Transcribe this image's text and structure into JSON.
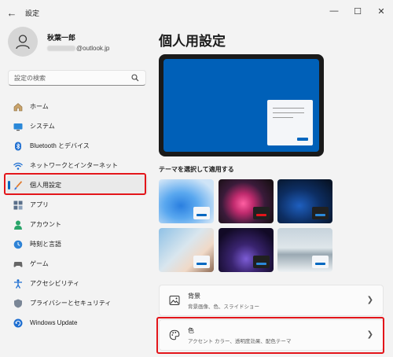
{
  "window": {
    "title": "設定",
    "back_icon": "←",
    "minimize": "—",
    "maximize": "☐",
    "close": "✕"
  },
  "profile": {
    "name": "秋葉一郎",
    "email_suffix": "@outlook.jp"
  },
  "search": {
    "placeholder": "設定の検索"
  },
  "nav": {
    "items": [
      {
        "label": "ホーム",
        "icon": "home-icon"
      },
      {
        "label": "システム",
        "icon": "monitor-icon"
      },
      {
        "label": "Bluetooth とデバイス",
        "icon": "bluetooth-icon"
      },
      {
        "label": "ネットワークとインターネット",
        "icon": "wifi-icon"
      },
      {
        "label": "個人用設定",
        "icon": "paintbrush-icon",
        "active": true
      },
      {
        "label": "アプリ",
        "icon": "apps-icon"
      },
      {
        "label": "アカウント",
        "icon": "person-icon"
      },
      {
        "label": "時刻と言語",
        "icon": "clock-globe-icon"
      },
      {
        "label": "ゲーム",
        "icon": "gamepad-icon"
      },
      {
        "label": "アクセシビリティ",
        "icon": "accessibility-icon"
      },
      {
        "label": "プライバシーとセキュリティ",
        "icon": "shield-icon"
      },
      {
        "label": "Windows Update",
        "icon": "update-icon"
      }
    ]
  },
  "main": {
    "title": "個人用設定",
    "themes_label": "テーマを選択して適用する",
    "cards": [
      {
        "title": "背景",
        "subtitle": "背景画像、色、スライドショー",
        "icon": "image-icon"
      },
      {
        "title": "色",
        "subtitle": "アクセント カラー、透明度効果、配色テーマ",
        "icon": "palette-icon"
      }
    ]
  },
  "colors": {
    "accent": "#0067c0",
    "highlight": "#e3151a"
  }
}
